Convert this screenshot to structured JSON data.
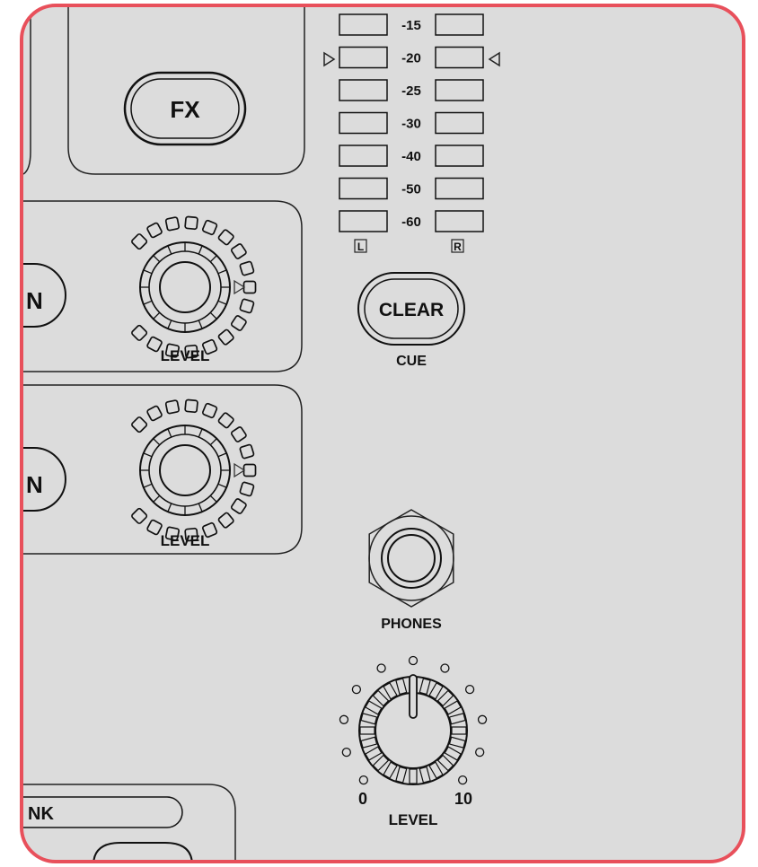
{
  "fx_button": "FX",
  "meter": {
    "scale": [
      "-15",
      "-20",
      "-25",
      "-30",
      "-40",
      "-50",
      "-60"
    ],
    "left_label": "L",
    "right_label": "R"
  },
  "cue": {
    "clear_button": "CLEAR",
    "label": "CUE"
  },
  "channels": [
    {
      "button_partial": "N",
      "knob_label": "LEVEL"
    },
    {
      "button_partial": "N",
      "knob_label": "LEVEL"
    }
  ],
  "phones": {
    "label": "PHONES"
  },
  "phones_level": {
    "label": "LEVEL",
    "min_label": "0",
    "max_label": "10"
  },
  "bank": {
    "label_partial": "NK"
  }
}
